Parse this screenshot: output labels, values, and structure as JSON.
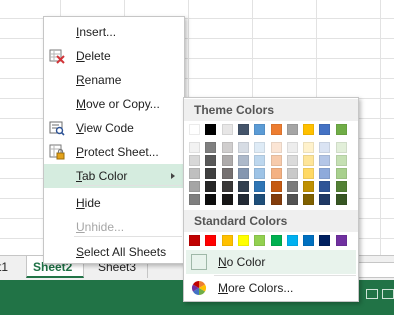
{
  "sheet_tabs": [
    "t1",
    "Sheet2",
    "Sheet3"
  ],
  "context_menu": {
    "items": [
      {
        "key": "insert",
        "label": "Insert...",
        "u": "I",
        "icon": "",
        "disabled": false,
        "highlight": false
      },
      {
        "key": "delete",
        "label": "Delete",
        "u": "D",
        "icon": "delete-sheet-icon",
        "disabled": false,
        "highlight": false
      },
      {
        "key": "rename",
        "label": "Rename",
        "u": "R",
        "icon": "",
        "disabled": false,
        "highlight": false
      },
      {
        "key": "move-or-copy",
        "label": "Move or Copy...",
        "u": "M",
        "icon": "",
        "disabled": false,
        "highlight": false
      },
      {
        "key": "view-code",
        "label": "View Code",
        "u": "V",
        "icon": "view-code-icon",
        "disabled": false,
        "highlight": false
      },
      {
        "key": "protect-sheet",
        "label": "Protect Sheet...",
        "u": "P",
        "icon": "protect-sheet-icon",
        "disabled": false,
        "highlight": false
      },
      {
        "key": "tab-color",
        "label": "Tab Color",
        "u": "T",
        "icon": "",
        "disabled": false,
        "highlight": true,
        "submenu": true
      },
      {
        "key": "hide",
        "label": "Hide",
        "u": "H",
        "icon": "",
        "disabled": false,
        "highlight": false
      },
      {
        "key": "unhide",
        "label": "Unhide...",
        "u": "U",
        "icon": "",
        "disabled": true,
        "highlight": false
      },
      {
        "key": "select-all-sheets",
        "label": "Select All Sheets",
        "u": "S",
        "icon": "",
        "disabled": false,
        "highlight": false
      }
    ]
  },
  "color_submenu": {
    "theme_title": "Theme Colors",
    "standard_title": "Standard Colors",
    "theme_top_row": [
      "#ffffff",
      "#000000",
      "#e7e6e6",
      "#44546a",
      "#5b9bd5",
      "#ed7d31",
      "#a5a5a5",
      "#ffc000",
      "#4472c4",
      "#70ad47"
    ],
    "theme_shades": [
      [
        "#f2f2f2",
        "#7f7f7f",
        "#d0cece",
        "#d6dce4",
        "#deebf6",
        "#fbe5d5",
        "#ededed",
        "#fff2cc",
        "#dae3f3",
        "#e2efd9"
      ],
      [
        "#d8d8d8",
        "#595959",
        "#aeabab",
        "#adb9ca",
        "#bdd7ee",
        "#f7cbac",
        "#dbdbdb",
        "#fee599",
        "#b4c6e7",
        "#c5e0b3"
      ],
      [
        "#bfbfbf",
        "#3f3f3f",
        "#757070",
        "#8496b0",
        "#9dc3e6",
        "#f4b183",
        "#c9c9c9",
        "#ffd965",
        "#8eaadb",
        "#a8d08d"
      ],
      [
        "#a5a5a5",
        "#262626",
        "#3a3838",
        "#323f4f",
        "#2e75b5",
        "#c55a11",
        "#7b7b7b",
        "#bf9000",
        "#2f5496",
        "#538135"
      ],
      [
        "#7f7f7f",
        "#0c0c0c",
        "#171616",
        "#222a35",
        "#1e4e79",
        "#833c0b",
        "#525252",
        "#7f6000",
        "#1f3864",
        "#375623"
      ]
    ],
    "standard_colors": [
      "#c00000",
      "#ff0000",
      "#ffc000",
      "#ffff00",
      "#92d050",
      "#00b050",
      "#00b0f0",
      "#0070c0",
      "#002060",
      "#7030a0"
    ],
    "no_color_label": "No Color",
    "no_color_u": "N",
    "more_colors_label": "More Colors...",
    "more_colors_u": "M"
  }
}
